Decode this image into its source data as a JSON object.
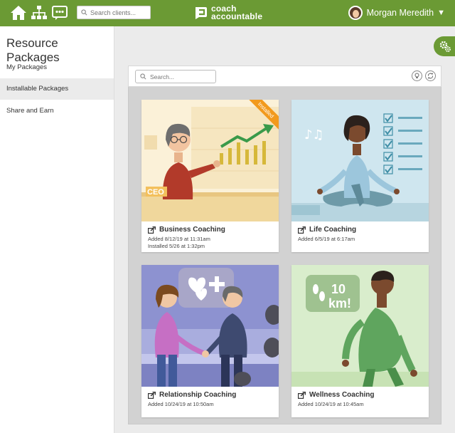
{
  "header": {
    "search_placeholder": "Search clients...",
    "logo_line1": "coach",
    "logo_line2": "accountable",
    "user_name": "Morgan Meredith",
    "user_caret": "▼",
    "brand_color": "#6b9a34"
  },
  "sidebar": {
    "title": "Resource Packages",
    "items": [
      {
        "label": "My Packages",
        "active": false
      },
      {
        "label": "Installable Packages",
        "active": true
      },
      {
        "label": "Share and Earn",
        "active": false
      }
    ]
  },
  "panel": {
    "search_placeholder": "Search..."
  },
  "packages": [
    {
      "title": "Business Coaching",
      "added": "Added 8/12/19 at 11:31am",
      "installed": "Installed 5/26 at 1:32pm",
      "ribbon": "Installed",
      "art_label": "CEO"
    },
    {
      "title": "Life Coaching",
      "added": "Added 6/5/19 at 6:17am"
    },
    {
      "title": "Relationship Coaching",
      "added": "Added 10/24/19 at 10:50am"
    },
    {
      "title": "Wellness Coaching",
      "added": "Added 10/24/19 at 10:45am",
      "art_label_1": "10",
      "art_label_2": "km!"
    }
  ]
}
